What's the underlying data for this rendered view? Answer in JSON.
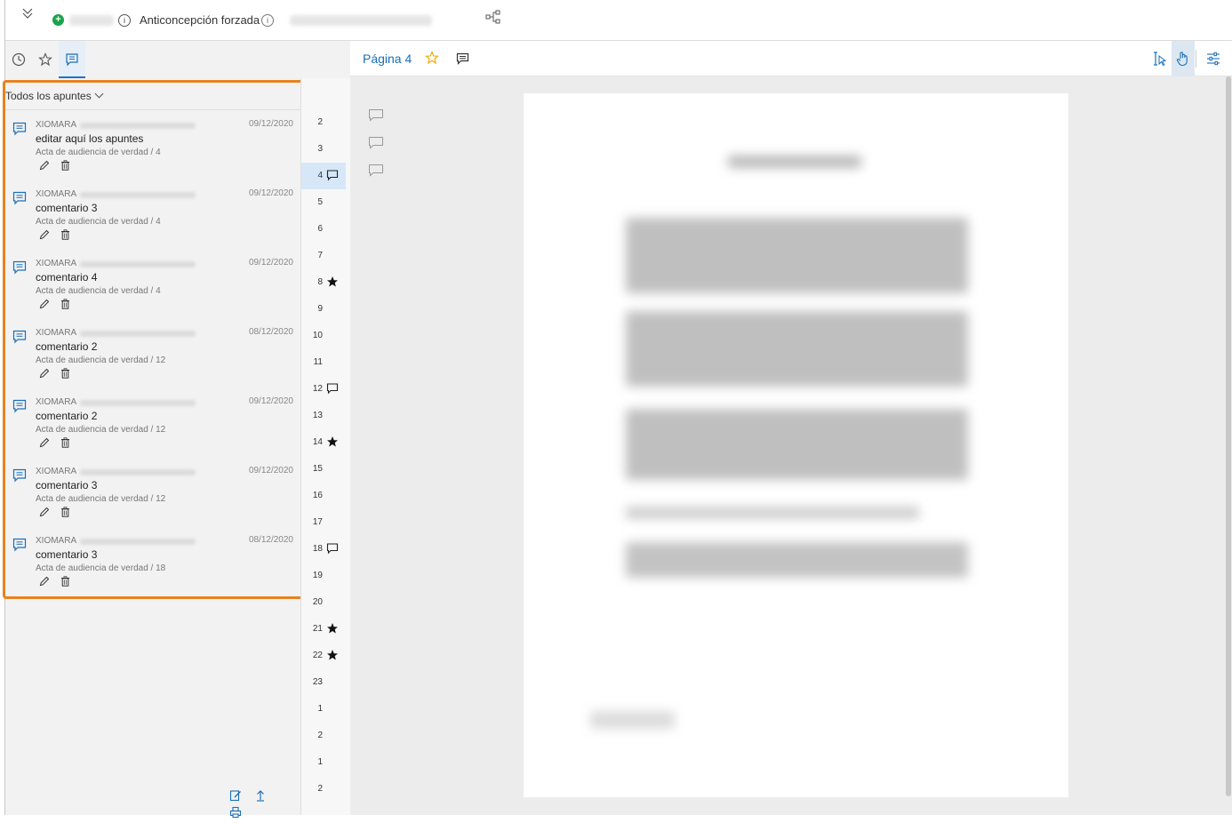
{
  "header": {
    "document_title": "Anticoncepción forzada",
    "info_symbol": "i"
  },
  "left_panel": {
    "tabs": [
      {
        "name": "history",
        "icon": "clock-icon"
      },
      {
        "name": "favorites",
        "icon": "star-icon"
      },
      {
        "name": "notes",
        "icon": "comment-icon",
        "active": true
      }
    ],
    "filter_label": "Todos los apuntes",
    "notes": [
      {
        "author": "XIOMARA",
        "date": "09/12/2020",
        "text": "editar aquí los apuntes",
        "source": "Acta de audiencia de verdad / 4"
      },
      {
        "author": "XIOMARA",
        "date": "09/12/2020",
        "text": "comentario 3",
        "source": "Acta de audiencia de verdad / 4"
      },
      {
        "author": "XIOMARA",
        "date": "09/12/2020",
        "text": "comentario 4",
        "source": "Acta de audiencia de verdad / 4"
      },
      {
        "author": "XIOMARA",
        "date": "08/12/2020",
        "text": "comentario 2",
        "source": "Acta de audiencia de verdad / 12"
      },
      {
        "author": "XIOMARA",
        "date": "09/12/2020",
        "text": "comentario 2",
        "source": "Acta de audiencia de verdad / 12"
      },
      {
        "author": "XIOMARA",
        "date": "09/12/2020",
        "text": "comentario 3",
        "source": "Acta de audiencia de verdad / 12"
      },
      {
        "author": "XIOMARA",
        "date": "08/12/2020",
        "text": "comentario 3",
        "source": "Acta de audiencia de verdad / 18"
      }
    ]
  },
  "page_index": [
    {
      "num": "2",
      "mark": ""
    },
    {
      "num": "3",
      "mark": ""
    },
    {
      "num": "4",
      "mark": "comment",
      "active": true
    },
    {
      "num": "5",
      "mark": ""
    },
    {
      "num": "6",
      "mark": ""
    },
    {
      "num": "7",
      "mark": ""
    },
    {
      "num": "8",
      "mark": "star"
    },
    {
      "num": "9",
      "mark": ""
    },
    {
      "num": "10",
      "mark": ""
    },
    {
      "num": "11",
      "mark": ""
    },
    {
      "num": "12",
      "mark": "comment"
    },
    {
      "num": "13",
      "mark": ""
    },
    {
      "num": "14",
      "mark": "star"
    },
    {
      "num": "15",
      "mark": ""
    },
    {
      "num": "16",
      "mark": ""
    },
    {
      "num": "17",
      "mark": ""
    },
    {
      "num": "18",
      "mark": "comment"
    },
    {
      "num": "19",
      "mark": ""
    },
    {
      "num": "20",
      "mark": ""
    },
    {
      "num": "21",
      "mark": "star"
    },
    {
      "num": "22",
      "mark": "star"
    },
    {
      "num": "23",
      "mark": ""
    },
    {
      "num": "1",
      "mark": ""
    },
    {
      "num": "2",
      "mark": ""
    },
    {
      "num": "1",
      "mark": ""
    },
    {
      "num": "2",
      "mark": ""
    }
  ],
  "viewer": {
    "page_label": "Página 4",
    "tools": [
      "text-select-icon",
      "hand-icon",
      "settings-sliders-icon"
    ],
    "active_tool": "hand-icon"
  },
  "colors": {
    "accent": "#1a6fb8",
    "highlight_border": "#e8821e",
    "active_row": "#d6e7f8",
    "green_add": "#1aa34a"
  }
}
